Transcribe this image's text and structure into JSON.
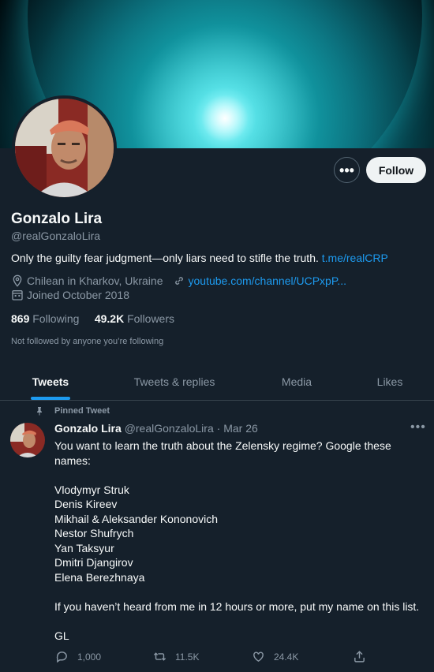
{
  "profile": {
    "name": "Gonzalo Lira",
    "handle": "@realGonzaloLira",
    "bio_text": "Only the guilty fear judgment—only liars need to stifle the truth.",
    "bio_link": "t.me/realCRP",
    "location": "Chilean in Kharkov, Ukraine",
    "website": "youtube.com/channel/UCPxpP...",
    "joined": "Joined October 2018",
    "following_count": "869",
    "following_label": "Following",
    "followers_count": "49.2K",
    "followers_label": "Followers",
    "not_followed": "Not followed by anyone you’re following",
    "follow_label": "Follow",
    "more_label": "•••"
  },
  "tabs": [
    {
      "label": "Tweets",
      "active": true
    },
    {
      "label": "Tweets & replies",
      "active": false
    },
    {
      "label": "Media",
      "active": false
    },
    {
      "label": "Likes",
      "active": false
    }
  ],
  "tweet": {
    "pinned_label": "Pinned Tweet",
    "author": "Gonzalo Lira",
    "handle": "@realGonzaloLira",
    "separator": "·",
    "date": "Mar 26",
    "lines": [
      "You want to learn the truth about the Zelensky regime? Google these names:",
      "",
      "Vlodymyr Struk",
      "Denis Kireev",
      "Mikhail & Aleksander Kononovich",
      "Nestor Shufrych",
      "Yan Taksyur",
      "Dmitri Djangirov",
      "Elena Berezhnaya",
      "",
      "If you haven’t heard from me in 12 hours or more, put my name on this list.",
      "",
      "GL"
    ],
    "replies": "1,000",
    "retweets": "11.5K",
    "likes": "24.4K"
  },
  "colors": {
    "background": "#15202b",
    "accent": "#1d9bf0",
    "muted": "#8b98a5"
  }
}
